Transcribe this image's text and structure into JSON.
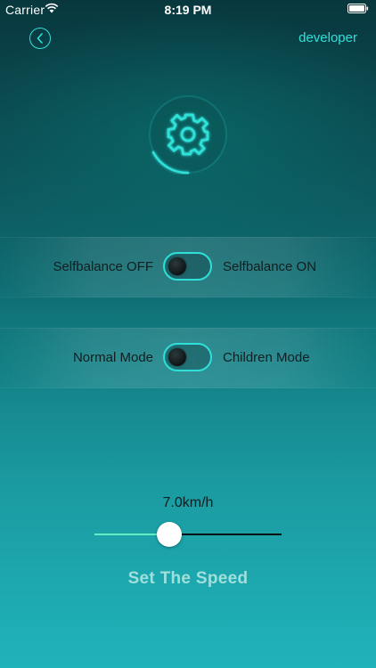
{
  "status_bar": {
    "carrier": "Carrier",
    "time": "8:19 PM",
    "wifi_icon": "wifi-icon",
    "battery_icon": "battery-icon"
  },
  "nav": {
    "back_icon": "chevron-left-icon",
    "developer_label": "developer"
  },
  "header_icon": "gear-icon",
  "toggles": [
    {
      "left_label": "Selfbalance OFF",
      "right_label": "Selfbalance ON",
      "state": "off"
    },
    {
      "left_label": "Normal Mode",
      "right_label": "Children Mode",
      "state": "off"
    }
  ],
  "speed": {
    "value_label": "7.0km/h",
    "slider_fraction": 0.4,
    "title": "Set The Speed"
  },
  "colors": {
    "accent": "#2fe0d8",
    "slider_fill": "#5ef0c0",
    "title_text": "#9fe0dc"
  }
}
